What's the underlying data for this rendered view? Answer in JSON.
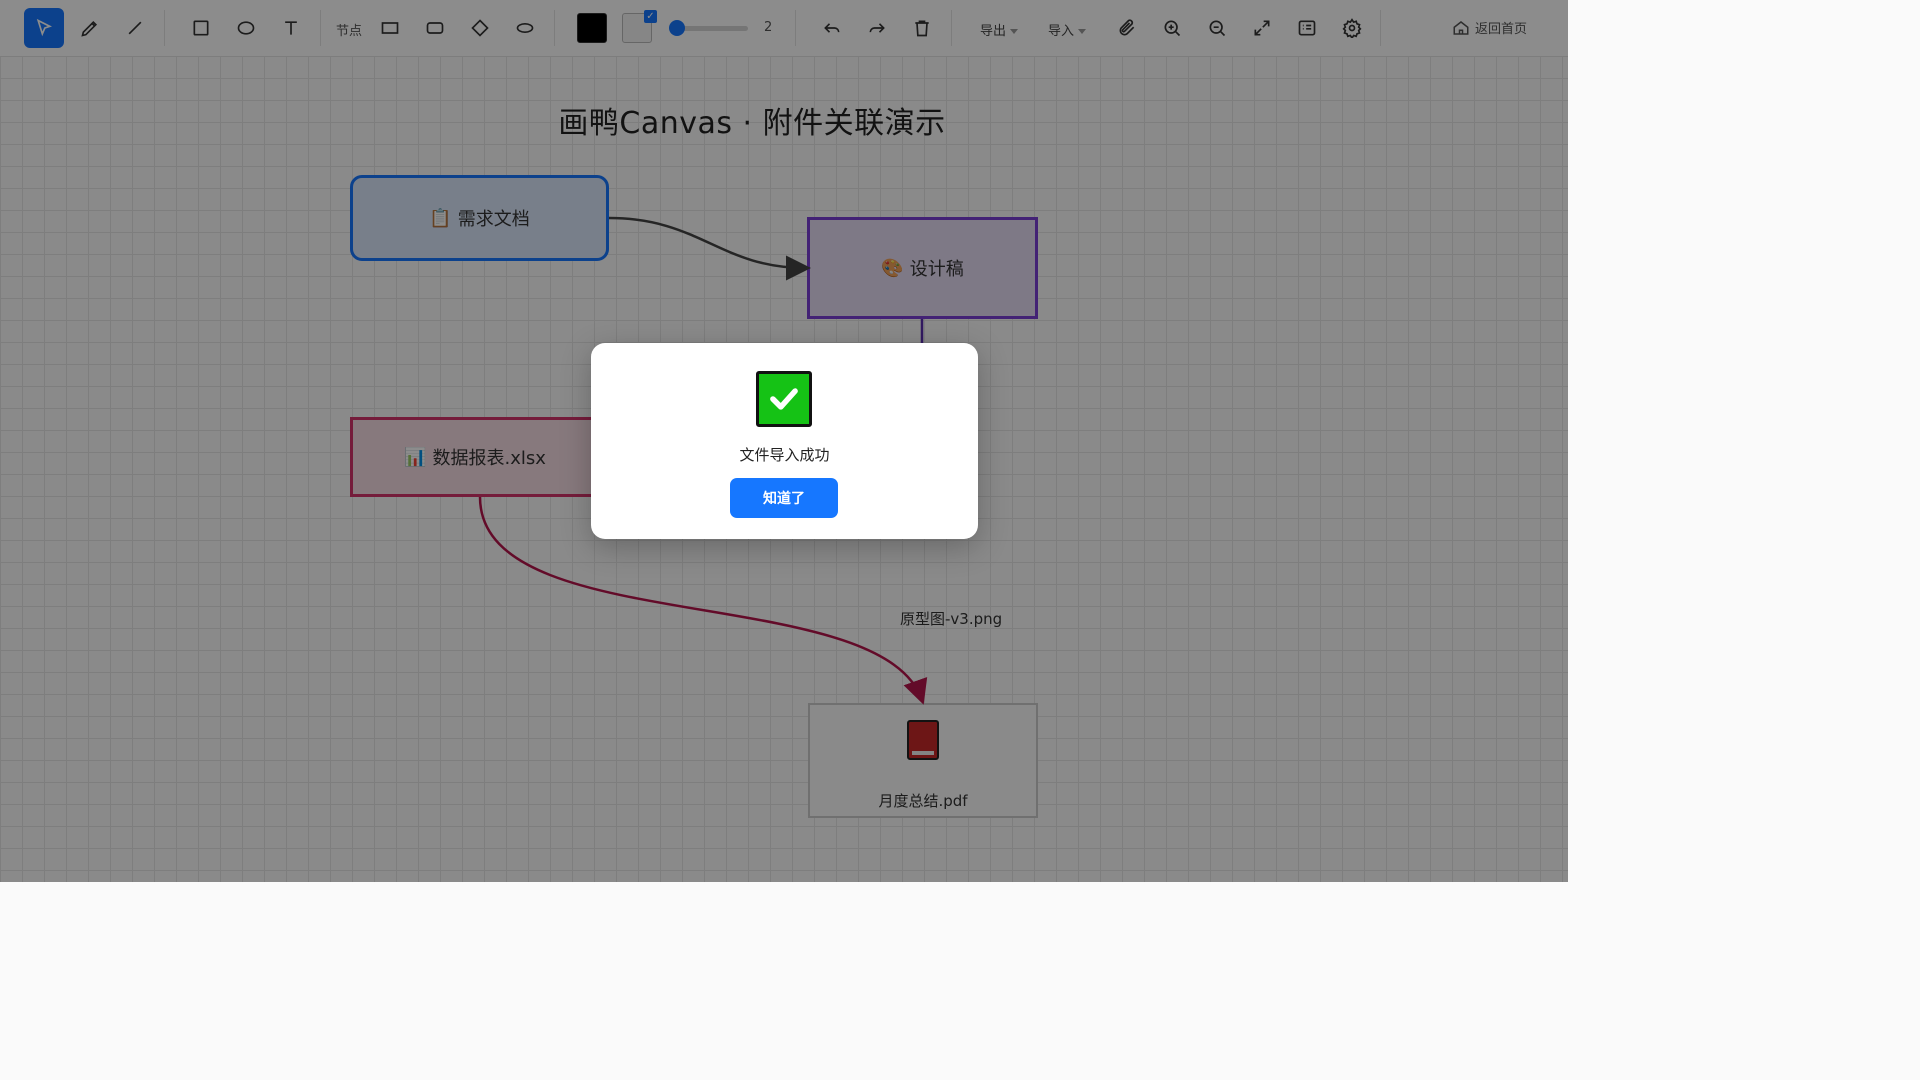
{
  "toolbar": {
    "tools": [
      {
        "name": "select-tool",
        "icon": "cursor-arrow-icon",
        "active": true
      },
      {
        "name": "pen-tool",
        "icon": "pen-icon"
      },
      {
        "name": "line-tool",
        "icon": "line-icon"
      },
      {
        "name": "rectangle-tool",
        "icon": "square-icon"
      },
      {
        "name": "ellipse-tool",
        "icon": "circle-icon"
      },
      {
        "name": "text-tool",
        "icon": "text-t-icon"
      }
    ],
    "node_label": "节点",
    "node_shapes": [
      "rectangle-icon",
      "rounded-rectangle-icon",
      "diamond-icon",
      "ellipse-icon"
    ],
    "stroke_color": "#000000",
    "fill_checked": true,
    "stroke_width": "2",
    "stroke_width_level": 0.05,
    "export_label": "导出",
    "import_label": "导入",
    "home_label": "返回首页",
    "accent_color": "#1677ff"
  },
  "canvas": {
    "title": "画鸭Canvas · 附件关联演示",
    "nodes": {
      "requirements": {
        "emoji": "📋",
        "label": "需求文档"
      },
      "design": {
        "emoji": "🎨",
        "label": "设计稿"
      },
      "data": {
        "emoji": "📊",
        "label": "数据报表.xlsx"
      },
      "pdf": {
        "label": "月度总结.pdf"
      }
    },
    "edge_label": "原型图-v3.png"
  },
  "modal": {
    "icon": "check-mark-icon",
    "message": "文件导入成功",
    "button_label": "知道了"
  }
}
